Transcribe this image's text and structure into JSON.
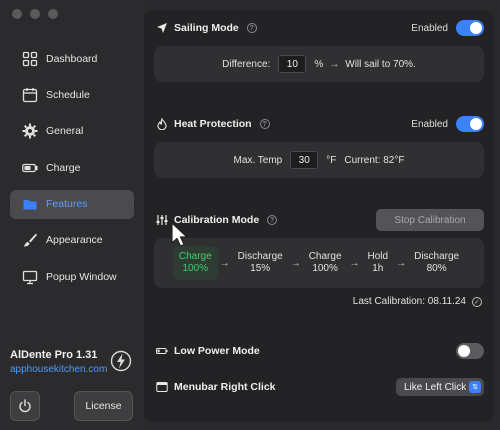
{
  "sidebar": {
    "items": [
      {
        "label": "Dashboard",
        "icon": "grid-icon"
      },
      {
        "label": "Schedule",
        "icon": "calendar-icon"
      },
      {
        "label": "General",
        "icon": "gear-icon"
      },
      {
        "label": "Charge",
        "icon": "battery-icon"
      },
      {
        "label": "Features",
        "icon": "folder-icon"
      },
      {
        "label": "Appearance",
        "icon": "brush-icon"
      },
      {
        "label": "Popup Window",
        "icon": "monitor-icon"
      }
    ],
    "active_index": 4,
    "brand_title": "AlDente Pro 1.31",
    "brand_link": "apphousekitchen.com",
    "license_label": "License"
  },
  "sailing": {
    "title": "Sailing Mode",
    "status": "Enabled",
    "enabled": true,
    "difference_label": "Difference:",
    "difference_value": "10",
    "unit": "%",
    "result": "Will sail to 70%."
  },
  "heat": {
    "title": "Heat Protection",
    "status": "Enabled",
    "enabled": true,
    "max_label": "Max. Temp",
    "max_value": "30",
    "unit": "°F",
    "current": "Current: 82°F"
  },
  "calibration": {
    "title": "Calibration Mode",
    "stop_label": "Stop Calibration",
    "steps": [
      {
        "name": "Charge",
        "value": "100%"
      },
      {
        "name": "Discharge",
        "value": "15%"
      },
      {
        "name": "Charge",
        "value": "100%"
      },
      {
        "name": "Hold",
        "value": "1h"
      },
      {
        "name": "Discharge",
        "value": "80%"
      }
    ],
    "last": "Last Calibration: 08.11.24"
  },
  "low_power": {
    "title": "Low Power Mode",
    "enabled": false
  },
  "menubar": {
    "title": "Menubar Right Click",
    "value": "Like Left Click"
  },
  "colors": {
    "accent": "#3b82f6",
    "active_step": "#3fce6b",
    "link": "#4c9cff"
  }
}
